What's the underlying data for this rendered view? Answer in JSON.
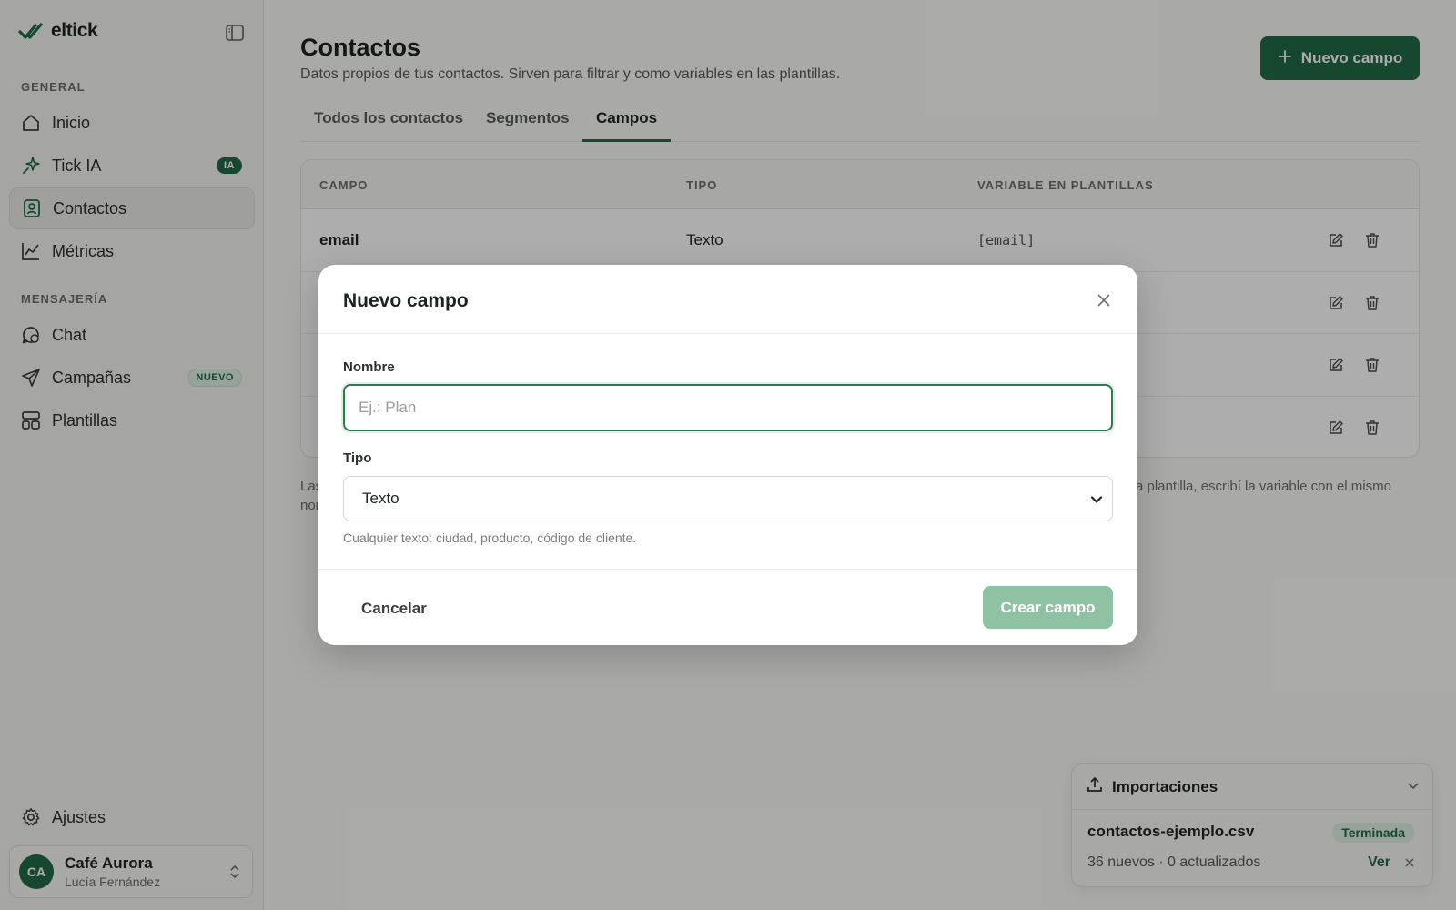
{
  "brand": {
    "name": "eltick"
  },
  "sidebar": {
    "section_general": "GENERAL",
    "section_messaging": "MENSAJERÍA",
    "items": [
      {
        "label": "Inicio",
        "icon": "home-icon"
      },
      {
        "label": "Tick IA",
        "icon": "sparkle-icon",
        "badge": "IA"
      },
      {
        "label": "Contactos",
        "icon": "contacts-icon",
        "active": true
      },
      {
        "label": "Métricas",
        "icon": "chart-icon"
      },
      {
        "label": "Chat",
        "icon": "chat-icon"
      },
      {
        "label": "Campañas",
        "icon": "send-icon",
        "badge": "NUEVO"
      },
      {
        "label": "Plantillas",
        "icon": "templates-icon"
      }
    ],
    "settings_label": "Ajustes",
    "account": {
      "initials": "CA",
      "name": "Café Aurora",
      "user": "Lucía Fernández"
    }
  },
  "header": {
    "title": "Contactos",
    "subtitle": "Datos propios de tus contactos. Sirven para filtrar y como variables en las plantillas.",
    "new_field_button": "Nuevo campo"
  },
  "tabs": [
    {
      "label": "Todos los contactos"
    },
    {
      "label": "Segmentos"
    },
    {
      "label": "Campos",
      "active": true
    }
  ],
  "table": {
    "columns": [
      "CAMPO",
      "TIPO",
      "VARIABLE EN PLANTILLAS"
    ],
    "rows": [
      {
        "name": "email",
        "type": "Texto",
        "variable": "[email]"
      },
      {
        "name": "",
        "type": "",
        "variable": ""
      },
      {
        "name": "",
        "type": "",
        "variable": ""
      },
      {
        "name": "",
        "type": "",
        "variable": ""
      }
    ]
  },
  "footnote": {
    "left_start": "Las",
    "left_end": "nor",
    "right_text": "a plantilla, escribí la variable con el mismo"
  },
  "modal": {
    "title": "Nuevo campo",
    "name_label": "Nombre",
    "name_placeholder": "Ej.: Plan",
    "name_value": "",
    "type_label": "Tipo",
    "type_selected": "Texto",
    "type_help": "Cualquier texto: ciudad, producto, código de cliente.",
    "cancel_label": "Cancelar",
    "create_label": "Crear campo"
  },
  "imports": {
    "title": "Importaciones",
    "file": "contactos-ejemplo.csv",
    "status": "Terminada",
    "summary": "36 nuevos · 0 actualizados",
    "view_label": "Ver"
  },
  "colors": {
    "accent": "#1f6a44",
    "accent_soft": "#dff0e4",
    "create_disabled": "#8fc2a2",
    "overlay": "rgba(0,0,0,0.32)"
  }
}
